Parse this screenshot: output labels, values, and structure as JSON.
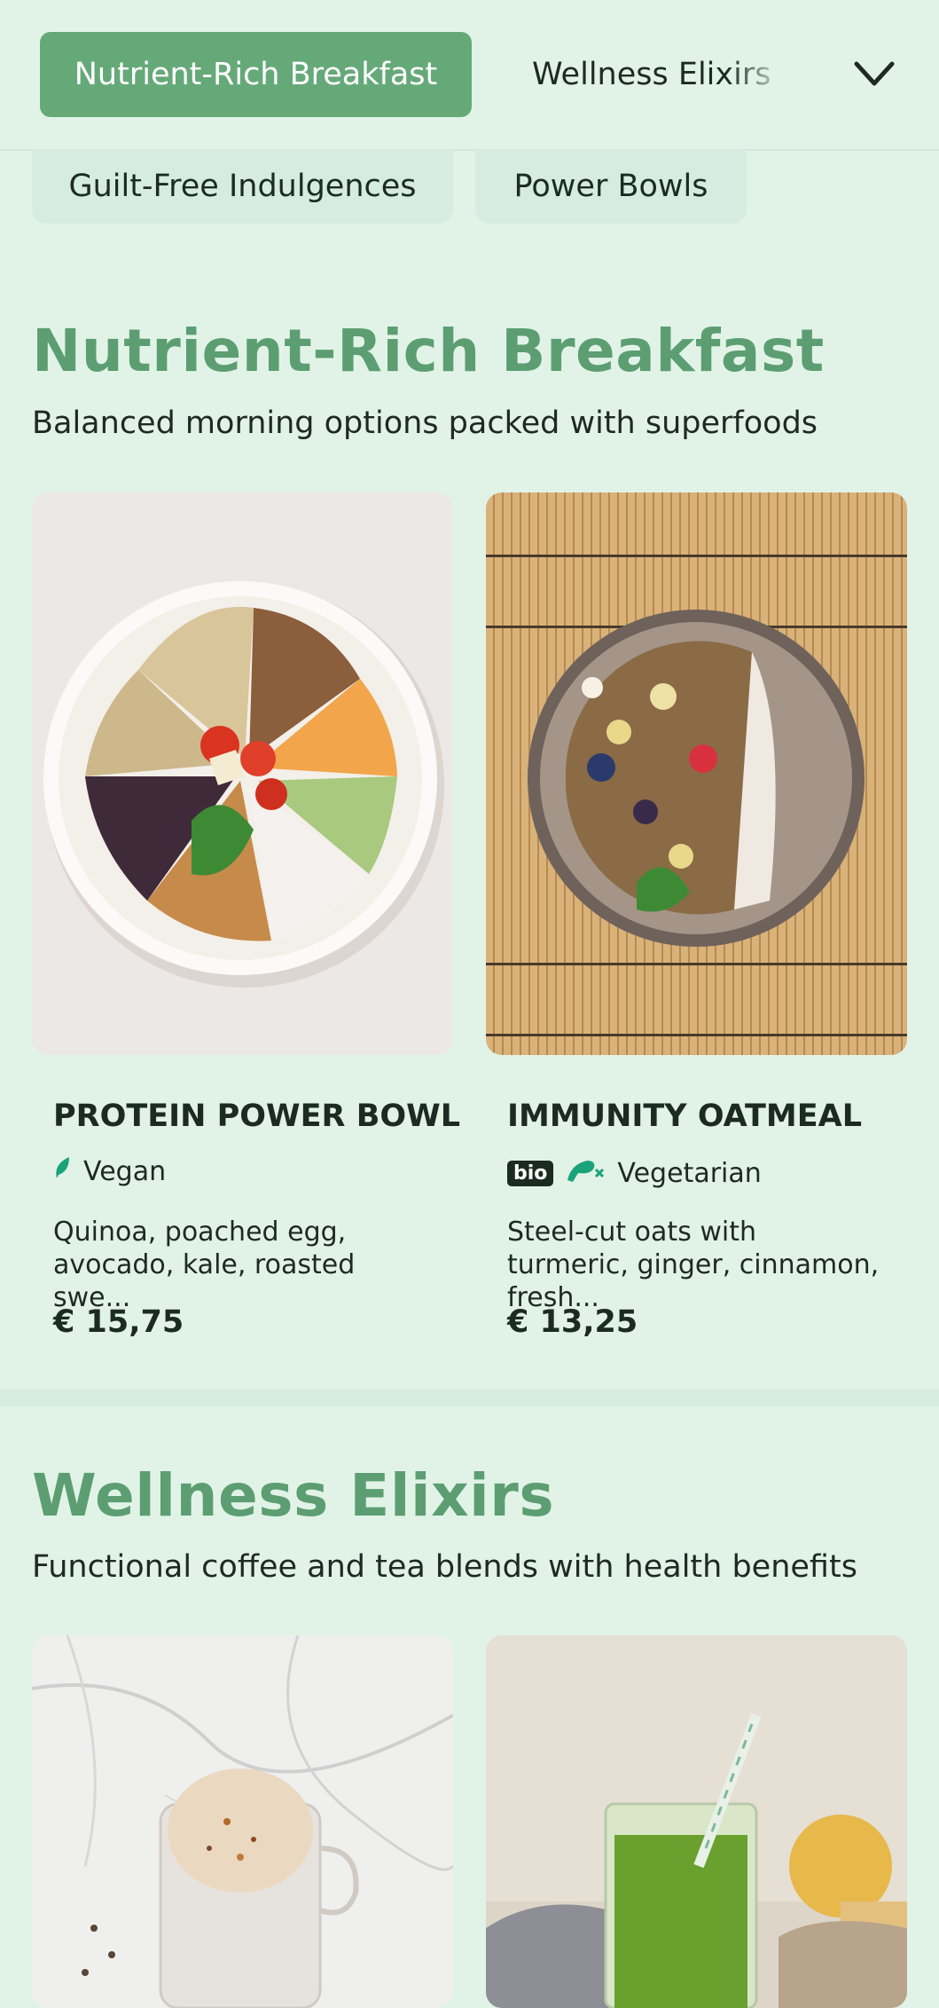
{
  "nav": {
    "tabs": [
      {
        "label": "Nutrient-Rich Breakfast",
        "active": true
      },
      {
        "label": "Wellness Elixirs",
        "active": false
      },
      {
        "label": "Guilt-Free Indulgences",
        "active": false
      },
      {
        "label": "Power Bowls",
        "active": false
      }
    ],
    "expand_icon": "chevron-down-icon"
  },
  "sections": [
    {
      "title": "Nutrient-Rich Breakfast",
      "subtitle": "Balanced morning options packed with superfoods",
      "items": [
        {
          "name": "PROTEIN POWER BOWL",
          "tags": [
            {
              "icon": "leaf-icon",
              "label": "Vegan"
            }
          ],
          "description": "Quinoa, poached egg, avocado, kale, roasted swe...",
          "price": "€ 15,75"
        },
        {
          "name": "IMMUNITY OATMEAL",
          "badge": "bio",
          "tags": [
            {
              "icon": "no-meat-icon",
              "label": "Vegetarian"
            }
          ],
          "description": "Steel-cut oats with turmeric, ginger, cinnamon, fresh...",
          "price": "€ 13,25"
        }
      ]
    },
    {
      "title": "Wellness Elixirs",
      "subtitle": "Functional coffee and tea blends with health benefits",
      "items": [
        {
          "image": "latte-image"
        },
        {
          "image": "green-juice-image"
        }
      ]
    }
  ],
  "colors": {
    "background": "#e1f3e7",
    "accent": "#66a979",
    "title_green": "#5c9e72",
    "text": "#1c2b22"
  }
}
